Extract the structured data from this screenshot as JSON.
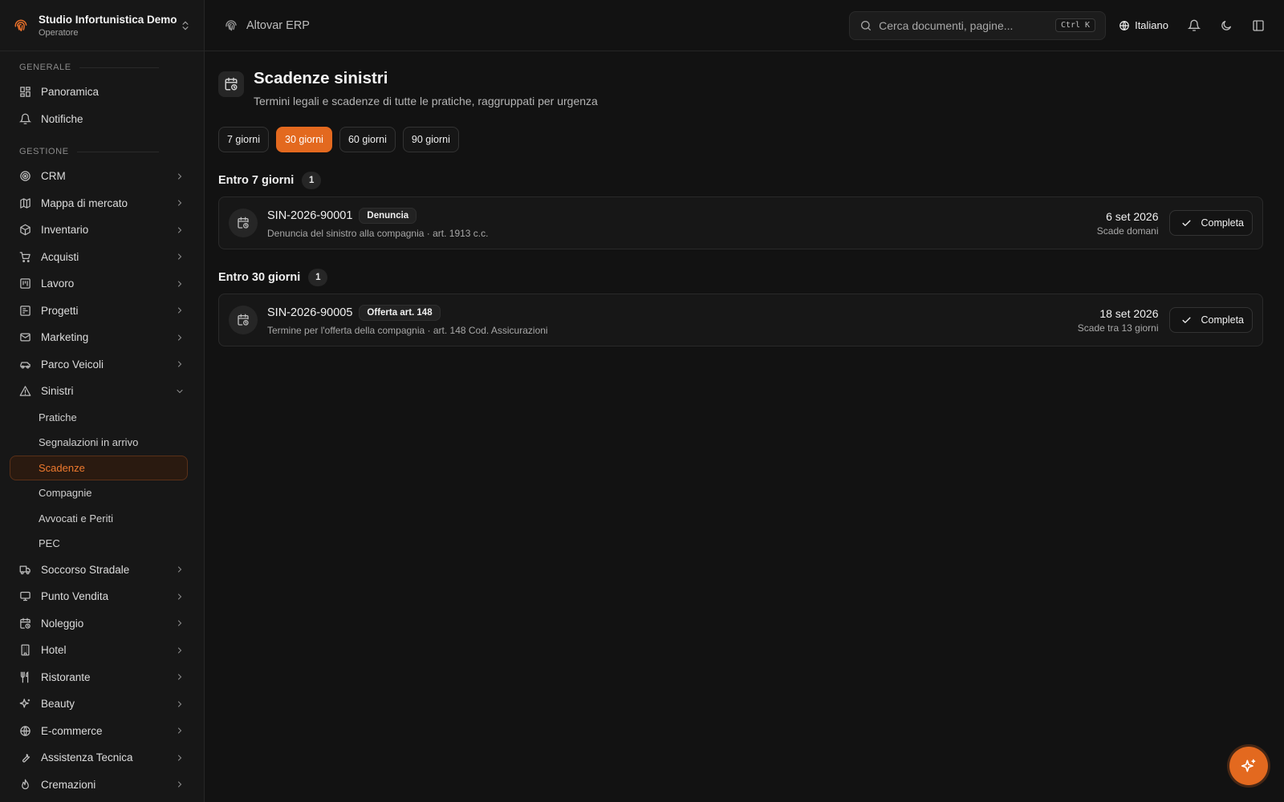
{
  "org": {
    "name": "Studio Infortunistica Demo",
    "role": "Operatore"
  },
  "app": {
    "name": "Altovar ERP"
  },
  "search": {
    "placeholder": "Cerca documenti, pagine...",
    "shortcut": "Ctrl K"
  },
  "language": "Italiano",
  "sidebar": {
    "sections": [
      {
        "label": "GENERALE",
        "items": [
          {
            "label": "Panoramica",
            "icon": "dashboard-icon"
          },
          {
            "label": "Notifiche",
            "icon": "bell-icon"
          }
        ]
      },
      {
        "label": "GESTIONE",
        "items": [
          {
            "label": "CRM",
            "icon": "target-icon"
          },
          {
            "label": "Mappa di mercato",
            "icon": "map-icon"
          },
          {
            "label": "Inventario",
            "icon": "package-icon"
          },
          {
            "label": "Acquisti",
            "icon": "cart-icon"
          },
          {
            "label": "Lavoro",
            "icon": "kanban-icon"
          },
          {
            "label": "Progetti",
            "icon": "project-icon"
          },
          {
            "label": "Marketing",
            "icon": "mail-icon"
          },
          {
            "label": "Parco Veicoli",
            "icon": "car-icon"
          },
          {
            "label": "Sinistri",
            "icon": "warning-icon",
            "expanded": true,
            "children": [
              {
                "label": "Pratiche"
              },
              {
                "label": "Segnalazioni in arrivo"
              },
              {
                "label": "Scadenze",
                "active": true
              },
              {
                "label": "Compagnie"
              },
              {
                "label": "Avvocati e Periti"
              },
              {
                "label": "PEC"
              }
            ]
          },
          {
            "label": "Soccorso Stradale",
            "icon": "truck-icon"
          },
          {
            "label": "Punto Vendita",
            "icon": "monitor-icon"
          },
          {
            "label": "Noleggio",
            "icon": "calendar-clock-icon"
          },
          {
            "label": "Hotel",
            "icon": "building-icon"
          },
          {
            "label": "Ristorante",
            "icon": "utensils-icon"
          },
          {
            "label": "Beauty",
            "icon": "sparkles-icon"
          },
          {
            "label": "E-commerce",
            "icon": "globe-icon"
          },
          {
            "label": "Assistenza Tecnica",
            "icon": "wrench-icon"
          },
          {
            "label": "Cremazioni",
            "icon": "flame-icon"
          }
        ]
      }
    ]
  },
  "page": {
    "title": "Scadenze sinistri",
    "subtitle": "Termini legali e scadenze di tutte le pratiche, raggruppati per urgenza"
  },
  "filters": [
    {
      "label": "7 giorni",
      "active": false
    },
    {
      "label": "30 giorni",
      "active": true
    },
    {
      "label": "60 giorni",
      "active": false
    },
    {
      "label": "90 giorni",
      "active": false
    }
  ],
  "groups": [
    {
      "title": "Entro 7 giorni",
      "count": "1",
      "items": [
        {
          "code": "SIN-2026-90001",
          "tag": "Denuncia",
          "description": "Denuncia del sinistro alla compagnia · art. 1913 c.c.",
          "date": "6 set 2026",
          "due": "Scade domani",
          "action": "Completa"
        }
      ]
    },
    {
      "title": "Entro 30 giorni",
      "count": "1",
      "items": [
        {
          "code": "SIN-2026-90005",
          "tag": "Offerta art. 148",
          "description": "Termine per l'offerta della compagnia · art. 148 Cod. Assicurazioni",
          "date": "18 set 2026",
          "due": "Scade tra 13 giorni",
          "action": "Completa"
        }
      ]
    }
  ],
  "colors": {
    "accent": "#e3691f",
    "background": "#121212",
    "sidebar": "#171717"
  }
}
